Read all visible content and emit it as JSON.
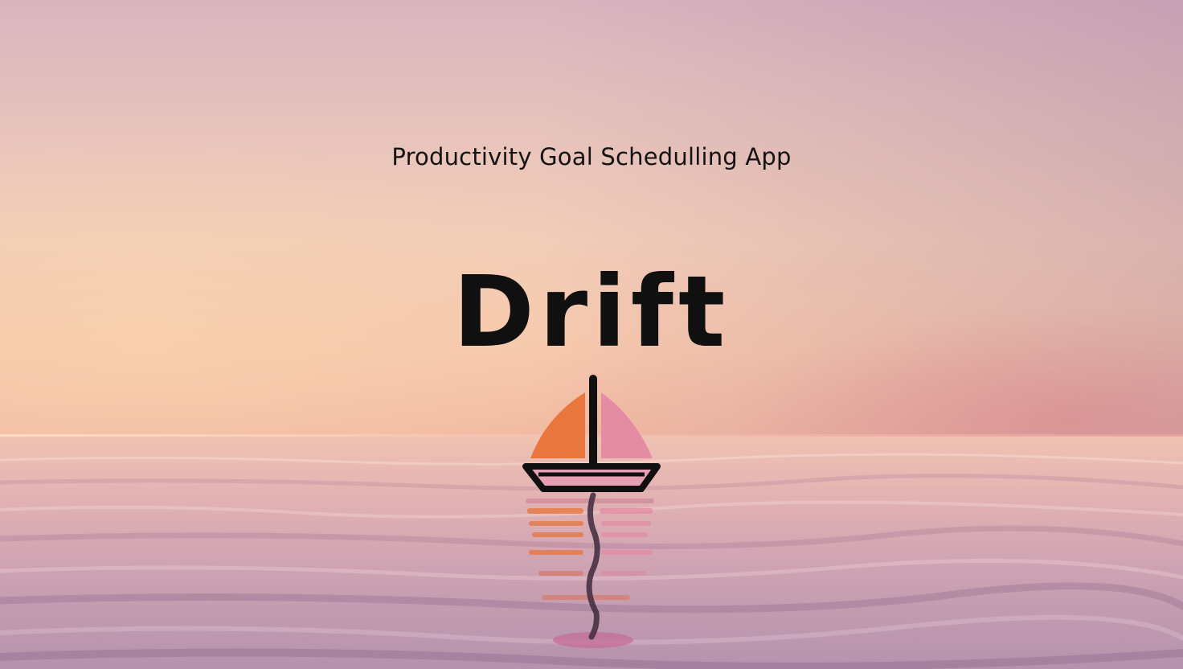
{
  "app": {
    "subtitle": "Productivity Goal Schedulling App",
    "title": "Drift"
  },
  "colors": {
    "sail_left": "#e8763d",
    "sail_right": "#e48ca3",
    "hull": "#e6a0b4",
    "outline": "#111010"
  },
  "icons": {
    "logo": "sailboat-icon"
  }
}
